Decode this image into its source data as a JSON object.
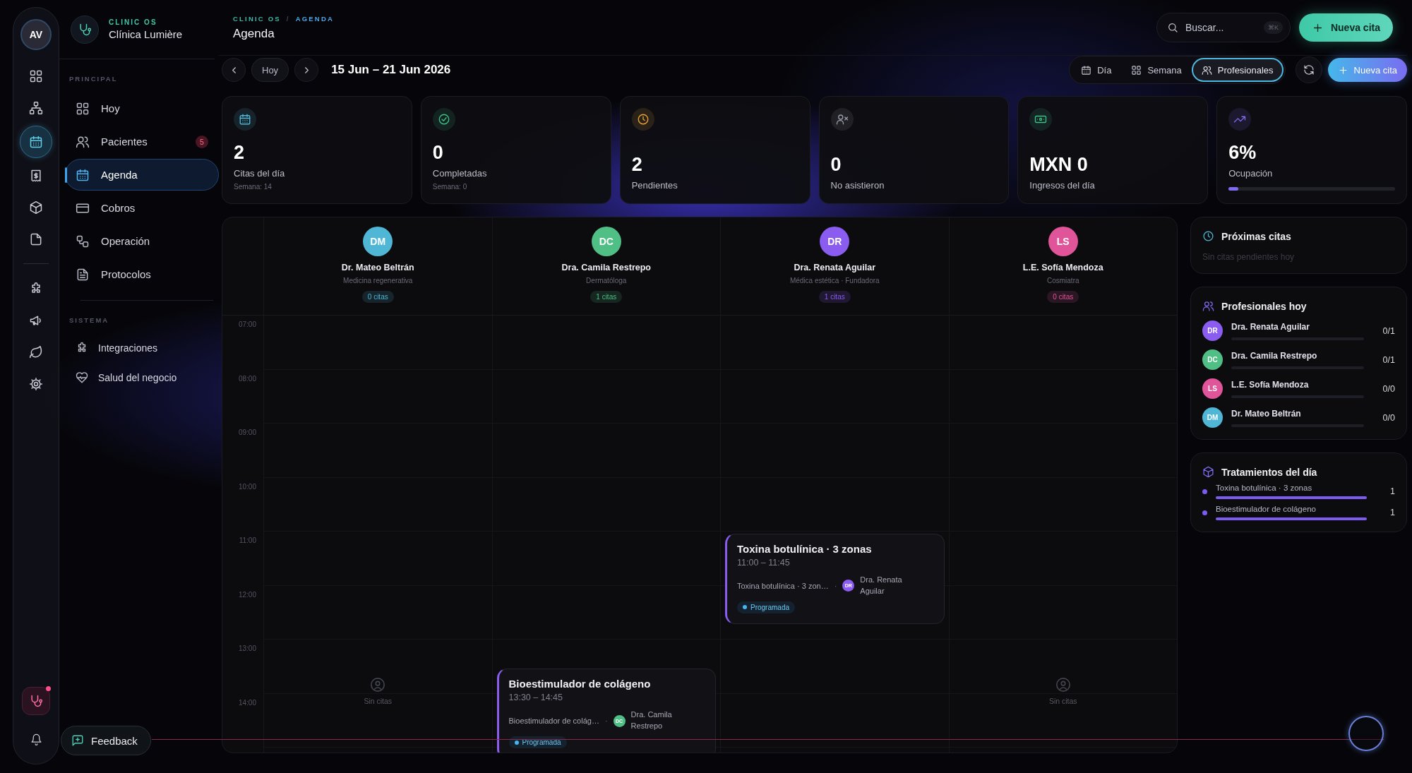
{
  "rail": {
    "avatar": "AV",
    "items": [
      {
        "kind": "grid",
        "selected": false
      },
      {
        "kind": "sitemap",
        "selected": false
      },
      {
        "kind": "calendar",
        "selected": true
      },
      {
        "kind": "receipt",
        "selected": false
      },
      {
        "kind": "box",
        "selected": false
      },
      {
        "kind": "file",
        "selected": false
      }
    ],
    "items_secondary": [
      {
        "kind": "puzzle",
        "selected": false
      },
      {
        "kind": "megaphone",
        "selected": false
      },
      {
        "kind": "leaf",
        "selected": false
      },
      {
        "kind": "gear",
        "selected": false
      }
    ],
    "bottom": [
      {
        "kind": "stethoscope",
        "alert": true
      },
      {
        "kind": "bell",
        "alert": false
      }
    ]
  },
  "sidebar": {
    "brand": {
      "eyebrow": "CLINIC OS",
      "name": "Clínica Lumière"
    },
    "sections": [
      {
        "title": "PRINCIPAL",
        "items": [
          {
            "label": "Hoy",
            "kind": "grid",
            "selected": false
          },
          {
            "label": "Pacientes",
            "kind": "users",
            "badge": "5",
            "selected": false
          },
          {
            "label": "Agenda",
            "kind": "calendar",
            "selected": true
          },
          {
            "label": "Cobros",
            "kind": "card",
            "selected": false
          },
          {
            "label": "Operación",
            "kind": "shapes",
            "selected": false
          },
          {
            "label": "Protocolos",
            "kind": "doc",
            "selected": false
          }
        ]
      },
      {
        "title": "SISTEMA",
        "items": [
          {
            "label": "Integraciones",
            "kind": "puzzle",
            "selected": false
          },
          {
            "label": "Salud del negocio",
            "kind": "heart",
            "selected": false
          }
        ]
      }
    ],
    "feedback": "Feedback"
  },
  "header": {
    "breadcrumb": [
      "CLINIC OS",
      "AGENDA"
    ],
    "separator": "/",
    "title": "Agenda",
    "search": {
      "placeholder": "Buscar...",
      "shortcut": "⌘K"
    },
    "primary_button": "Nueva cita"
  },
  "toolbar": {
    "today": "Hoy",
    "range": "15 Jun – 21 Jun 2026",
    "views": [
      {
        "label": "Día",
        "kind": "calendar",
        "selected": false
      },
      {
        "label": "Semana",
        "kind": "grid",
        "selected": false
      },
      {
        "label": "Profesionales",
        "kind": "users",
        "selected": true
      }
    ],
    "new_button": "Nueva cita"
  },
  "stats": [
    {
      "kind": "calendar",
      "color": "#4fb6d6",
      "value": "2",
      "label": "Citas del día",
      "sub": "Semana: 14"
    },
    {
      "kind": "check",
      "color": "#3fbf86",
      "value": "0",
      "label": "Completadas",
      "sub": "Semana: 0"
    },
    {
      "kind": "clock",
      "color": "#e8a23a",
      "value": "2",
      "label": "Pendientes"
    },
    {
      "kind": "userx",
      "color": "#9a9aa8",
      "value": "0",
      "label": "No asistieron"
    },
    {
      "kind": "cash",
      "color": "#3fbf86",
      "value": "MXN 0",
      "label": "Ingresos del día"
    },
    {
      "kind": "trend",
      "color": "#7c6cf0",
      "value": "6%",
      "label": "Ocupación",
      "level": 0.06
    }
  ],
  "calendar": {
    "hours": [
      "07:00",
      "08:00",
      "09:00",
      "10:00",
      "11:00",
      "12:00",
      "13:00",
      "14:00"
    ],
    "professionals": [
      {
        "initials": "DM",
        "name": "Dr. Mateo Beltrán",
        "role": "Medicina regenerativa",
        "count": "0 citas",
        "color": "#4fb6d6",
        "empty": "Sin citas"
      },
      {
        "initials": "DC",
        "name": "Dra. Camila Restrepo",
        "role": "Dermatóloga",
        "count": "1 citas",
        "color": "#4fbf86",
        "appointments": [
          {
            "title": "Bioestimulador de colágeno",
            "time": "13:30 – 14:45",
            "treatment": "Bioestimulador de colág…",
            "separator": "·",
            "doctor_initials": "DC",
            "doctor": "Dra. Camila Restrepo",
            "status": "Programada"
          }
        ]
      },
      {
        "initials": "DR",
        "name": "Dra. Renata Aguilar",
        "role": "Médica estética · Fundadora",
        "count": "1 citas",
        "color": "#8b5cf0",
        "appointments": [
          {
            "title": "Toxina botulínica · 3 zonas",
            "time": "11:00 – 11:45",
            "treatment": "Toxina botulínica · 3 zon…",
            "separator": "·",
            "doctor_initials": "DR",
            "doctor": "Dra. Renata Aguilar",
            "status": "Programada"
          }
        ]
      },
      {
        "initials": "LS",
        "name": "L.E. Sofía Mendoza",
        "role": "Cosmiatra",
        "count": "0 citas",
        "color": "#e0559a",
        "empty": "Sin citas"
      }
    ]
  },
  "upcoming": {
    "title": "Próximas citas",
    "empty": "Sin citas pendientes hoy"
  },
  "professionals_today": {
    "title": "Profesionales hoy",
    "items": [
      {
        "initials": "DR",
        "name": "Dra. Renata Aguilar",
        "ratio": "0/1",
        "color": "#8b5cf0",
        "level": 0
      },
      {
        "initials": "DC",
        "name": "Dra. Camila Restrepo",
        "ratio": "0/1",
        "color": "#4fbf86",
        "level": 0
      },
      {
        "initials": "LS",
        "name": "L.E. Sofía Mendoza",
        "ratio": "0/0",
        "color": "#e0559a",
        "level": 0
      },
      {
        "initials": "DM",
        "name": "Dr. Mateo Beltrán",
        "ratio": "0/0",
        "color": "#4fb6d6",
        "level": 0
      }
    ]
  },
  "treatments": {
    "title": "Tratamientos del día",
    "items": [
      {
        "name": "Toxina botulínica · 3 zonas",
        "count": "1",
        "color": "#7c5cf0",
        "level": 1
      },
      {
        "name": "Bioestimulador de colágeno",
        "count": "1",
        "color": "#7c5cf0",
        "level": 1
      }
    ]
  }
}
